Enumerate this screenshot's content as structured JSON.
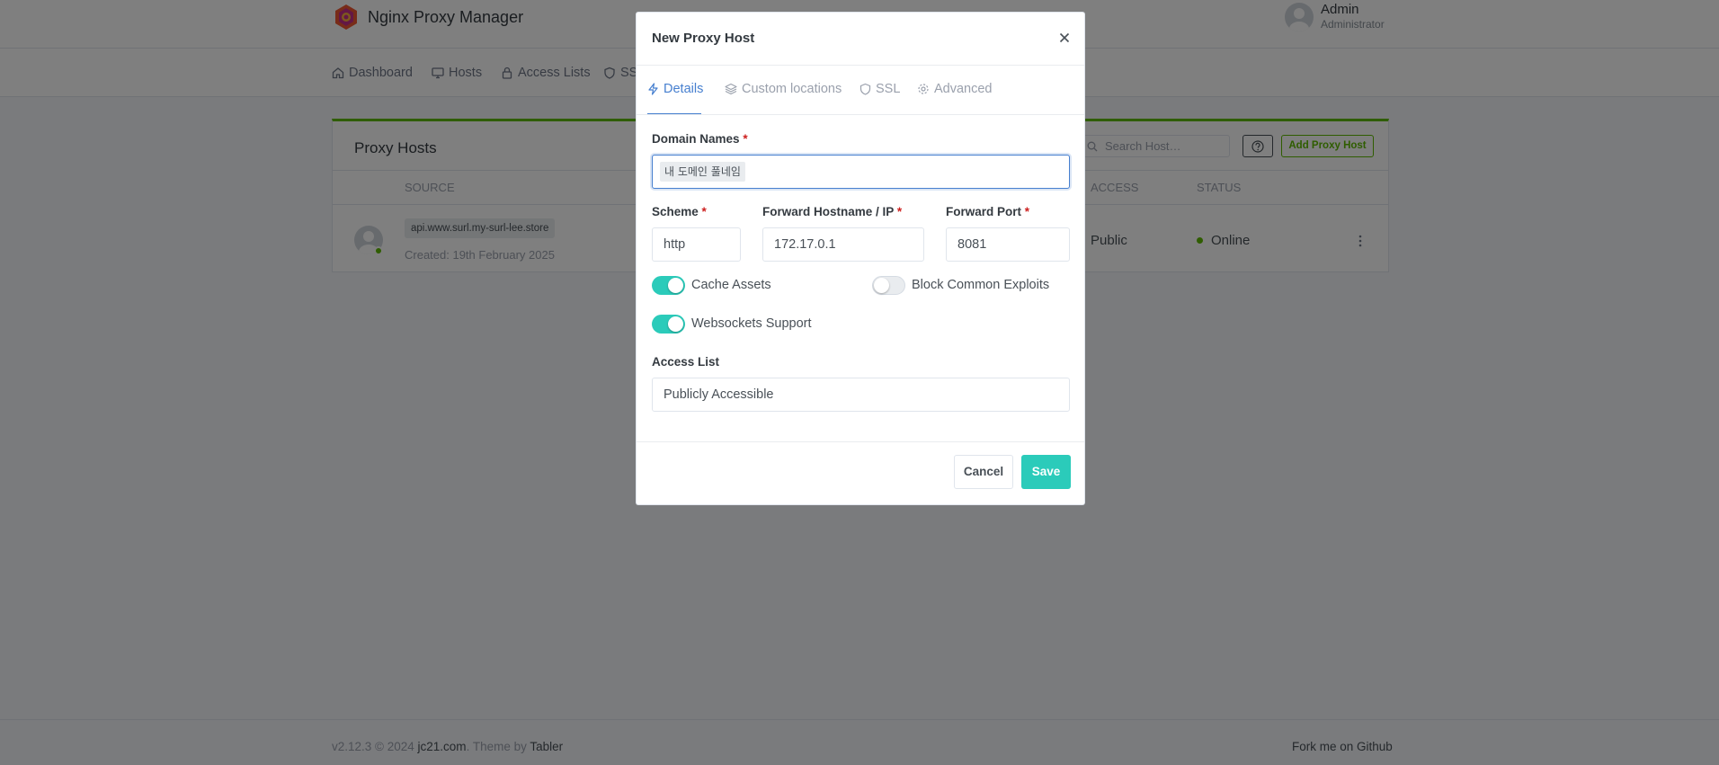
{
  "header": {
    "brand": "Nginx Proxy Manager",
    "user_name": "Admin",
    "user_role": "Administrator"
  },
  "nav": {
    "dashboard": "Dashboard",
    "hosts": "Hosts",
    "access_lists": "Access Lists",
    "ssl": "SSL"
  },
  "card": {
    "title": "Proxy Hosts",
    "search_placeholder": "Search Host…",
    "add_button": "Add Proxy Host",
    "columns": {
      "source": "SOURCE",
      "access": "ACCESS",
      "status": "STATUS"
    },
    "row": {
      "source": "api.www.surl.my-surl-lee.store",
      "created": "Created: 19th February 2025",
      "access": "Public",
      "status": "Online"
    }
  },
  "footer": {
    "version": "v2.12.3 © 2024",
    "company": "jc21.com",
    "theme_by": ". Theme by",
    "tabler": "Tabler",
    "fork": "Fork me on Github"
  },
  "modal": {
    "title": "New Proxy Host",
    "tabs": {
      "details": "Details",
      "custom_locations": "Custom locations",
      "ssl": "SSL",
      "advanced": "Advanced"
    },
    "domain_names_label": "Domain Names",
    "domain_tag": "내 도메인 풀네임",
    "scheme_label": "Scheme",
    "scheme_value": "http",
    "forward_host_label": "Forward Hostname / IP",
    "forward_host_value": "172.17.0.1",
    "forward_port_label": "Forward Port",
    "forward_port_value": "8081",
    "required_mark": "*",
    "cache_assets": "Cache Assets",
    "block_exploits": "Block Common Exploits",
    "websockets": "Websockets Support",
    "toggles": {
      "cache_assets": true,
      "block_exploits": false,
      "websockets": true
    },
    "access_list_label": "Access List",
    "access_list_value": "Publicly Accessible",
    "cancel": "Cancel",
    "save": "Save"
  },
  "colors": {
    "accent": "#2bcbba",
    "active_tab": "#467fcf",
    "success": "#5eba00",
    "required": "#cd201f"
  }
}
